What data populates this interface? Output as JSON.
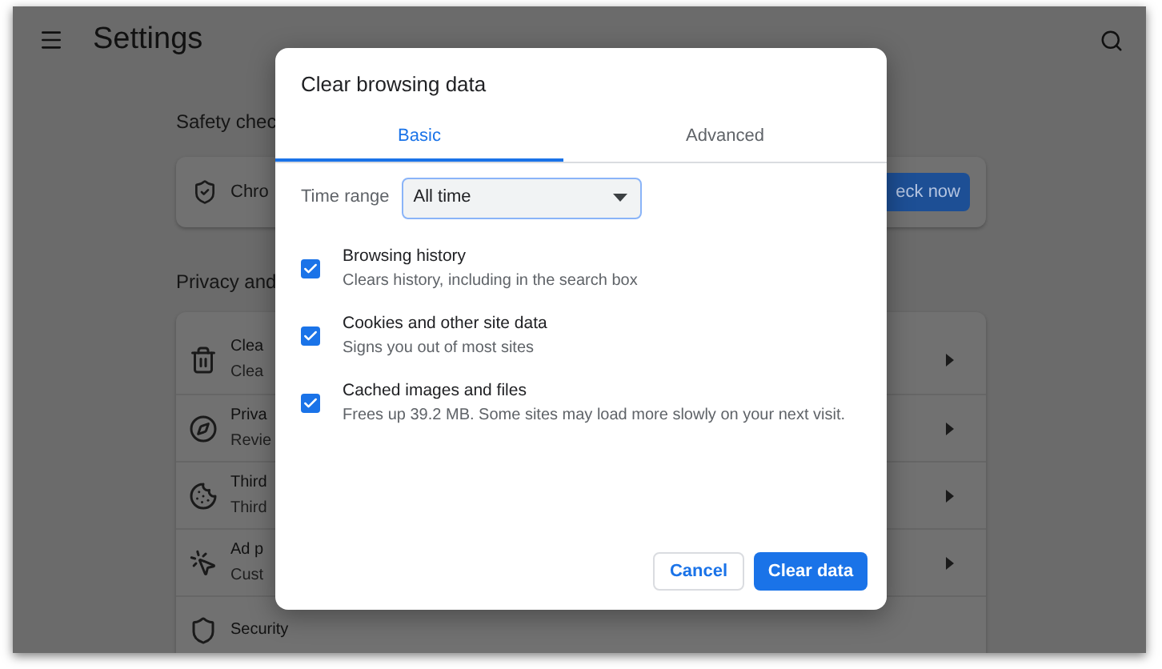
{
  "header": {
    "title": "Settings"
  },
  "safety_check": {
    "heading": "Safety chec",
    "item": "Chro",
    "button": "eck now"
  },
  "privacy": {
    "heading": "Privacy and",
    "rows": [
      {
        "kind": "trash",
        "title": "Clea",
        "subtitle": "Clea"
      },
      {
        "kind": "compass",
        "title": "Priva",
        "subtitle": "Revie"
      },
      {
        "kind": "cookie",
        "title": "Third",
        "subtitle": "Third"
      },
      {
        "kind": "target",
        "title": "Ad p",
        "subtitle": "Cust"
      },
      {
        "kind": "shield",
        "title": "Security"
      }
    ]
  },
  "dialog": {
    "title": "Clear browsing data",
    "tabs": [
      {
        "label": "Basic",
        "selected": true
      },
      {
        "label": "Advanced",
        "selected": false
      }
    ],
    "time_range": {
      "label": "Time range",
      "value": "All time"
    },
    "options": [
      {
        "title": "Browsing history",
        "description": "Clears history, including in the search box",
        "checked": true
      },
      {
        "title": "Cookies and other site data",
        "description": "Signs you out of most sites",
        "checked": true
      },
      {
        "title": "Cached images and files",
        "description": "Frees up 39.2 MB. Some sites may load more slowly on your next visit.",
        "checked": true
      }
    ],
    "buttons": {
      "cancel": "Cancel",
      "confirm": "Clear data"
    }
  }
}
